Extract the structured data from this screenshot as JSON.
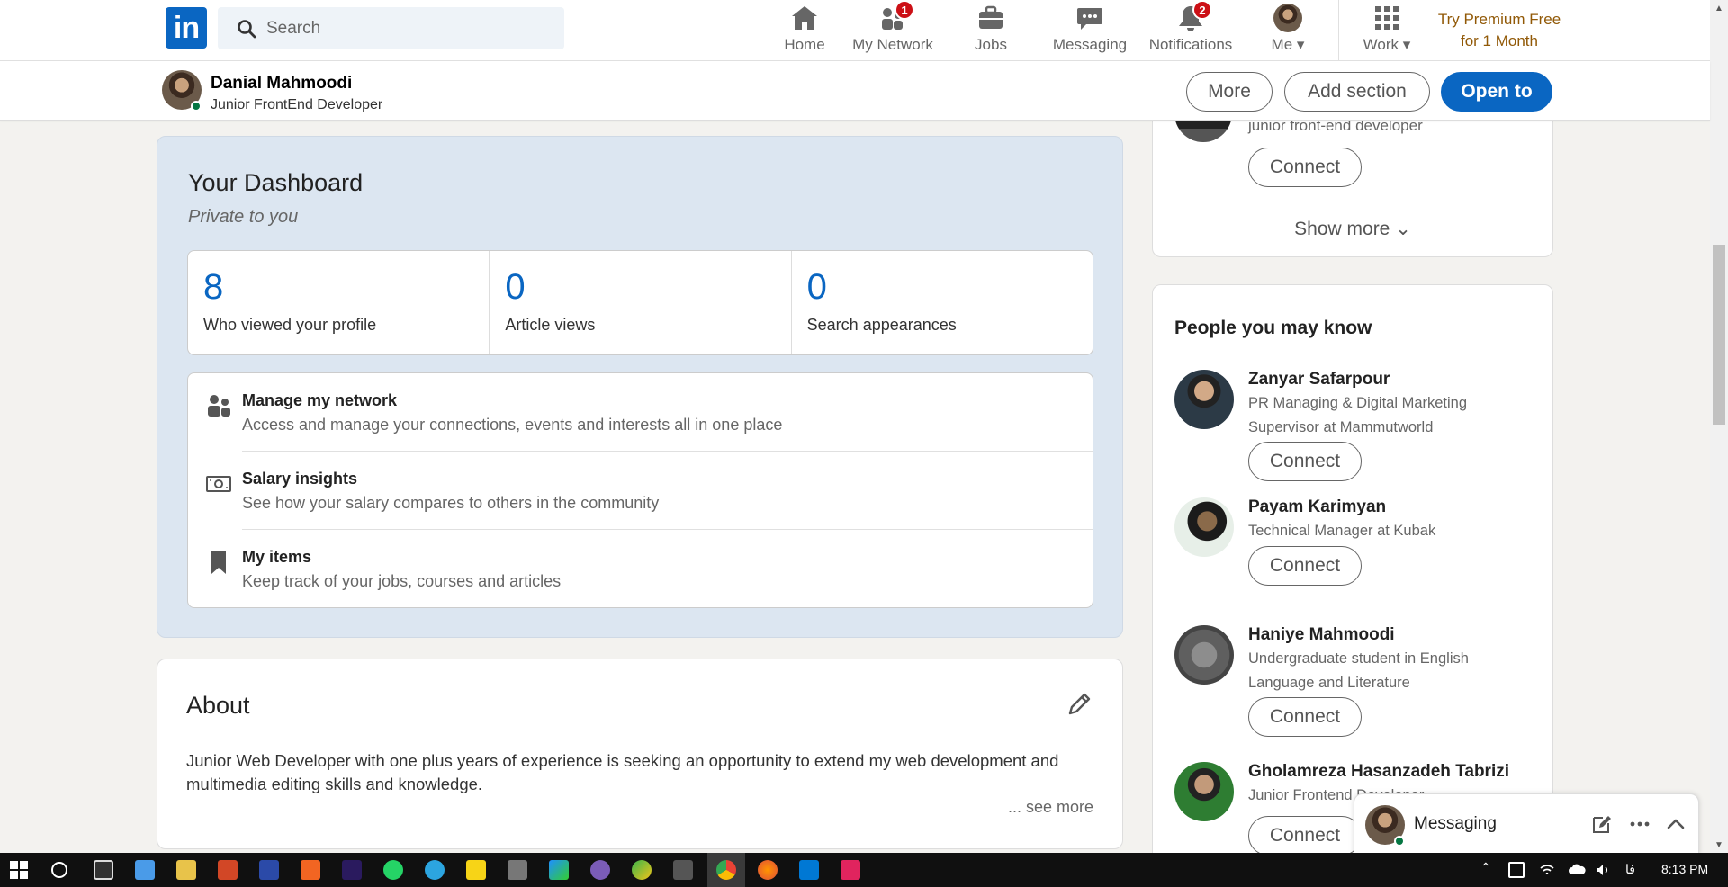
{
  "nav": {
    "search_placeholder": "Search",
    "items": [
      {
        "label": "Home",
        "icon": "home-icon"
      },
      {
        "label": "My Network",
        "icon": "network-icon",
        "badge": "1"
      },
      {
        "label": "Jobs",
        "icon": "briefcase-icon"
      },
      {
        "label": "Messaging",
        "icon": "chat-icon"
      },
      {
        "label": "Notifications",
        "icon": "bell-icon",
        "badge": "2"
      },
      {
        "label": "Me",
        "icon": "avatar"
      },
      {
        "label": "Work",
        "icon": "grid-icon"
      }
    ],
    "premium_line1": "Try Premium Free",
    "premium_line2": "for 1 Month"
  },
  "profile_bar": {
    "name": "Danial Mahmoodi",
    "title": "Junior FrontEnd Developer",
    "buttons": {
      "more": "More",
      "add_section": "Add section",
      "open_to": "Open to"
    }
  },
  "dashboard": {
    "title": "Your Dashboard",
    "subtitle": "Private to you",
    "stats": [
      {
        "value": "8",
        "label": "Who viewed your profile"
      },
      {
        "value": "0",
        "label": "Article views"
      },
      {
        "value": "0",
        "label": "Search appearances"
      }
    ],
    "links": [
      {
        "title": "Manage my network",
        "desc": "Access and manage your connections, events and interests all in one place"
      },
      {
        "title": "Salary insights",
        "desc": "See how your salary compares to others in the community"
      },
      {
        "title": "My items",
        "desc": "Keep track of your jobs, courses and articles"
      }
    ]
  },
  "about": {
    "title": "About",
    "text": "Junior Web Developer with one plus years of experience is seeking an opportunity to extend my web development and multimedia editing skills and knowledge.",
    "see_more": "... see more"
  },
  "right_top": {
    "headline": "junior front-end developer",
    "connect_label": "Connect",
    "show_more": "Show more"
  },
  "pymk": {
    "title": "People you may know",
    "connect_label": "Connect",
    "people": [
      {
        "name": "Zanyar Safarpour",
        "headline": "PR Managing & Digital Marketing Supervisor at Mammutworld"
      },
      {
        "name": "Payam Karimyan",
        "headline": "Technical Manager at Kubak"
      },
      {
        "name": "Haniye Mahmoodi",
        "headline": "Undergraduate student in English Language and Literature"
      },
      {
        "name": "Gholamreza Hasanzadeh Tabrizi",
        "headline": "Junior Frontend Developer"
      }
    ]
  },
  "messaging": {
    "label": "Messaging"
  },
  "taskbar": {
    "lang": "فا",
    "time": "8:13 PM"
  },
  "colors": {
    "brand": "#0a66c2",
    "badge": "#cc1016",
    "premium": "#915907",
    "online": "#057642"
  }
}
